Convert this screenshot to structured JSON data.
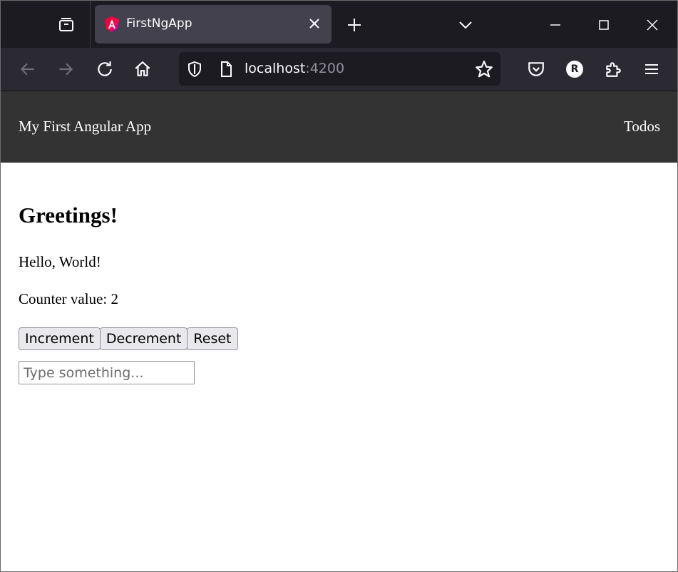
{
  "browser": {
    "tab_title": "FirstNgApp",
    "url_host": "localhost",
    "url_port": ":4200",
    "account_initial": "R"
  },
  "icons": {
    "tab_overview": "tab-overview-icon",
    "favicon": "angular-logo-icon",
    "tab_close": "close-icon",
    "new_tab": "plus-icon",
    "list_tabs": "chevron-down-icon",
    "minimize": "minimize-icon",
    "maximize": "maximize-icon",
    "close_window": "close-icon",
    "back": "arrow-left-icon",
    "forward": "arrow-right-icon",
    "reload": "reload-icon",
    "home": "home-icon",
    "shield": "shield-icon",
    "page": "page-icon",
    "bookmark": "star-icon",
    "pocket": "pocket-icon",
    "extensions": "puzzle-icon",
    "menu": "hamburger-icon"
  },
  "colors": {
    "tabstrip_bg": "#1c1b22",
    "active_tab_bg": "#42414d",
    "toolbar_bg": "#2b2a33",
    "app_header_bg": "#333333",
    "button_bg": "#e9e9ed"
  },
  "app": {
    "header": {
      "title": "My First Angular App",
      "nav_link": "Todos"
    },
    "main": {
      "heading": "Greetings!",
      "greeting": "Hello, World!",
      "counter_label": "Counter value: 2",
      "buttons": {
        "increment": "Increment",
        "decrement": "Decrement",
        "reset": "Reset"
      },
      "input": {
        "value": "",
        "placeholder": "Type something..."
      }
    }
  }
}
